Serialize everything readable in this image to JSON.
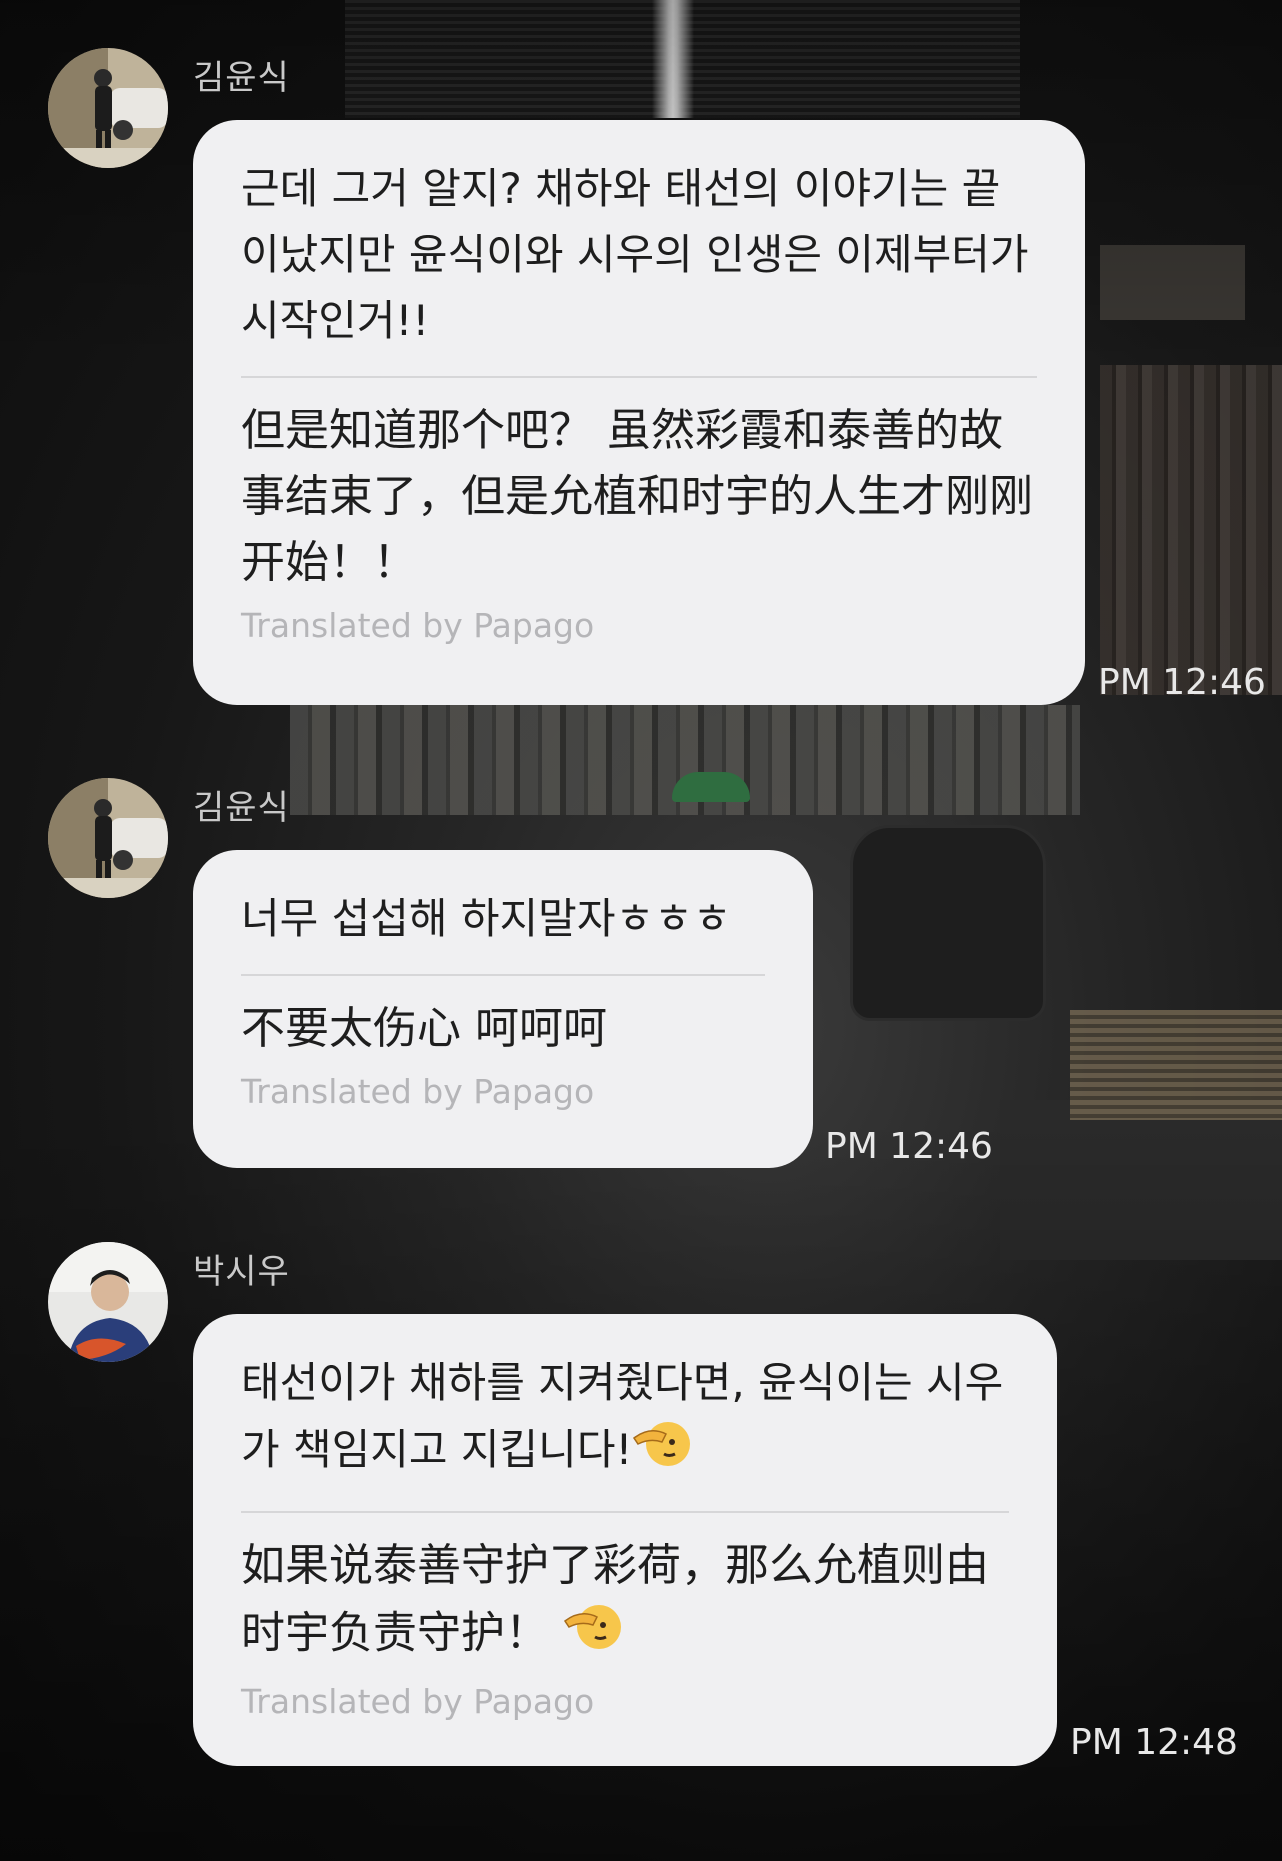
{
  "messages": [
    {
      "sender": "김윤식",
      "original": "근데 그거 알지? 채하와 태선의 이야기는 끝이났지만 윤식이와 시우의 인생은 이제부터가 시작인거!!",
      "translation": "但是知道那个吧？  虽然彩霞和泰善的故事结束了，但是允植和时宇的人生才刚刚开始！！",
      "credit": "Translated by Papago",
      "time": "PM 12:46"
    },
    {
      "sender": "김윤식",
      "original": "너무 섭섭해 하지말자ㅎㅎㅎ",
      "translation": "不要太伤心 呵呵呵",
      "credit": "Translated by Papago",
      "time": "PM 12:46"
    },
    {
      "sender": "박시우",
      "original": "태선이가 채하를 지켜줬다면, 윤식이는 시우가 책임지고 지킵니다!",
      "translation": "如果说泰善守护了彩荷，那么允植则由时宇负责守护！",
      "credit": "Translated by Papago",
      "time": "PM 12:48",
      "emoji": "saluting-face-icon"
    }
  ],
  "colors": {
    "bubble": "#f0f0f2",
    "text": "#1e1e1e",
    "credit": "#b5b5b8",
    "sender": "#c9c9c9",
    "time": "#e8e8e8"
  }
}
